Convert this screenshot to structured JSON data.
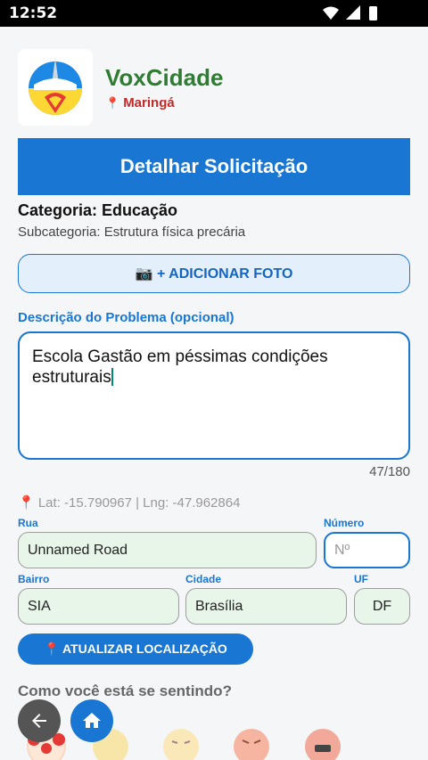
{
  "status_bar": {
    "time": "12:52",
    "icons": [
      "wifi-icon",
      "signal-icon",
      "battery-icon"
    ]
  },
  "header": {
    "app_name": "VoxCidade",
    "city": "Maringá"
  },
  "title": "Detalhar Solicitação",
  "category": "Categoria: Educação",
  "subcategory": "Subcategoria: Estrutura física precária",
  "photo_button": "📷 + ADICIONAR FOTO",
  "description": {
    "label": "Descrição do Problema (opcional)",
    "value": "Escola Gastão em péssimas condições estruturais",
    "counter": "47/180"
  },
  "coords": "📍 Lat: -15.790967 | Lng: -47.962864",
  "address": {
    "rua_label": "Rua",
    "rua_value": "Unnamed Road",
    "numero_label": "Número",
    "numero_placeholder": "Nº",
    "bairro_label": "Bairro",
    "bairro_value": "SIA",
    "cidade_label": "Cidade",
    "cidade_value": "Brasília",
    "uf_label": "UF",
    "uf_value": "DF"
  },
  "location_button": "📍 ATUALIZAR LOCALIZAÇÃO",
  "feeling": {
    "title": "Como você está se sentindo?"
  },
  "colors": {
    "primary": "#1976d2",
    "brand_green": "#2e7d32",
    "city_red": "#c62828"
  }
}
